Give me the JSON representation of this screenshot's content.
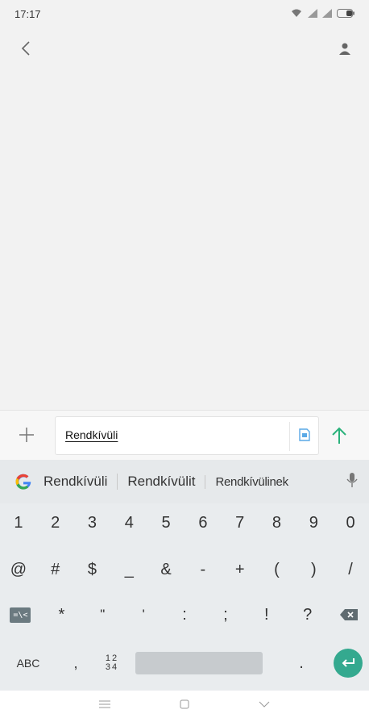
{
  "status_bar": {
    "time": "17:17",
    "icons": [
      "wifi-icon",
      "signal-icon",
      "signal-icon",
      "battery-icon"
    ]
  },
  "top_bar": {
    "back_icon": "back-chevron-icon",
    "contact_icon": "person-icon"
  },
  "compose": {
    "attach_icon": "plus-icon",
    "message_text": "Rendkívüli",
    "sim_icon": "sim-card-icon",
    "send_icon": "send-arrow-icon",
    "accent_color": "#2ab27b"
  },
  "keyboard": {
    "logo_icon": "google-g-icon",
    "suggestions": [
      "Rendkívüli",
      "Rendkívülit",
      "Rendkívülinek"
    ],
    "mic_icon": "microphone-icon",
    "row_numbers": [
      "1",
      "2",
      "3",
      "4",
      "5",
      "6",
      "7",
      "8",
      "9",
      "0"
    ],
    "row_symbols1": [
      "@",
      "#",
      "$",
      "_",
      "&",
      "-",
      "+",
      "(",
      ")",
      "/"
    ],
    "row_symbols2": [
      "*",
      "\"",
      "'",
      ":",
      ";",
      "!",
      "?"
    ],
    "symbols_toggle": "=\\<",
    "abc_label": "ABC",
    "comma_label": ",",
    "numpad_top": "12",
    "numpad_bottom": "34",
    "period_label": ".",
    "enter_color": "#34a98f"
  },
  "nav_bar": {
    "icons": [
      "menu-icon",
      "home-icon",
      "back-icon"
    ]
  }
}
